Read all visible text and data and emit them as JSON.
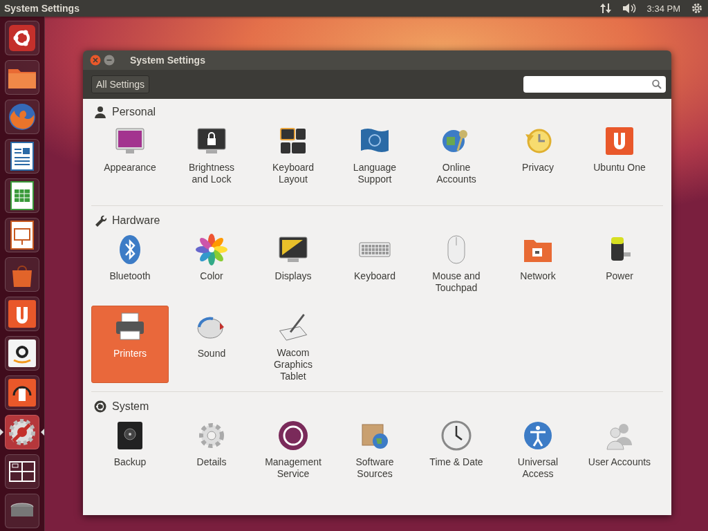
{
  "top_bar": {
    "title": "System Settings",
    "clock": "3:34 PM"
  },
  "launcher": [
    {
      "kind": "dash",
      "active": false
    },
    {
      "kind": "files",
      "active": false
    },
    {
      "kind": "browser",
      "active": false
    },
    {
      "kind": "writer",
      "active": false
    },
    {
      "kind": "calc",
      "active": false
    },
    {
      "kind": "impress",
      "active": false
    },
    {
      "kind": "store",
      "active": false
    },
    {
      "kind": "one",
      "active": false
    },
    {
      "kind": "shop",
      "active": false
    },
    {
      "kind": "music",
      "active": false
    },
    {
      "kind": "settings",
      "active": true
    },
    {
      "kind": "workspaces",
      "active": false
    },
    {
      "kind": "trash",
      "active": false
    }
  ],
  "window": {
    "title": "System Settings",
    "all_settings": "All Settings",
    "sections": [
      {
        "kind": "personal",
        "title": "Personal",
        "items": [
          {
            "kind": "appearance",
            "label": "Appearance",
            "selected": false
          },
          {
            "kind": "lock",
            "label": "Brightness\nand Lock",
            "selected": false
          },
          {
            "kind": "layout",
            "label": "Keyboard\nLayout",
            "selected": false
          },
          {
            "kind": "language",
            "label": "Language\nSupport",
            "selected": false
          },
          {
            "kind": "accounts",
            "label": "Online\nAccounts",
            "selected": false
          },
          {
            "kind": "privacy",
            "label": "Privacy",
            "selected": false
          },
          {
            "kind": "one",
            "label": "Ubuntu One",
            "selected": false
          }
        ]
      },
      {
        "kind": "hardware",
        "title": "Hardware",
        "items": [
          {
            "kind": "bluetooth",
            "label": "Bluetooth",
            "selected": false
          },
          {
            "kind": "color",
            "label": "Color",
            "selected": false
          },
          {
            "kind": "displays",
            "label": "Displays",
            "selected": false
          },
          {
            "kind": "keyboard",
            "label": "Keyboard",
            "selected": false
          },
          {
            "kind": "mouse",
            "label": "Mouse and\nTouchpad",
            "selected": false
          },
          {
            "kind": "network",
            "label": "Network",
            "selected": false
          },
          {
            "kind": "power",
            "label": "Power",
            "selected": false
          },
          {
            "kind": "printer",
            "label": "Printers",
            "selected": true
          },
          {
            "kind": "sound",
            "label": "Sound",
            "selected": false
          },
          {
            "kind": "wacom",
            "label": "Wacom\nGraphics\nTablet",
            "selected": false
          }
        ]
      },
      {
        "kind": "system",
        "title": "System",
        "items": [
          {
            "kind": "backup",
            "label": "Backup",
            "selected": false
          },
          {
            "kind": "details",
            "label": "Details",
            "selected": false
          },
          {
            "kind": "management",
            "label": "Management\nService",
            "selected": false
          },
          {
            "kind": "sources",
            "label": "Software\nSources",
            "selected": false
          },
          {
            "kind": "clock",
            "label": "Time & Date",
            "selected": false
          },
          {
            "kind": "access",
            "label": "Universal\nAccess",
            "selected": false
          },
          {
            "kind": "users",
            "label": "User Accounts",
            "selected": false
          }
        ]
      }
    ]
  }
}
